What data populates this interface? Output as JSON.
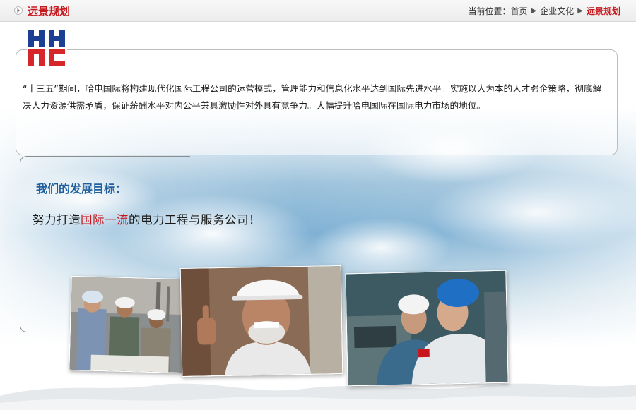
{
  "header": {
    "section_title": "远景规划",
    "breadcrumb": {
      "label": "当前位置：",
      "items": [
        "首页",
        "企业文化",
        "远景规划"
      ]
    }
  },
  "logo": {
    "text": "HEC"
  },
  "intro": {
    "text": "“十三五”期间，哈电国际将构建现代化国际工程公司的运营模式，管理能力和信息化水平达到国际先进水平。实施以人为本的人才强企策略，彻底解决人力资源供需矛盾，保证薪酬水平对内公平兼具激励性对外具有竞争力。大幅提升哈电国际在国际电力市场的地位。"
  },
  "goal": {
    "title": "我们的发展目标：",
    "text_before": "努力打造",
    "text_highlight": "国际一流",
    "text_after": "的电力工程与服务公司！"
  },
  "colors": {
    "accent_red": "#c8161d",
    "goal_blue": "#1f5f9e",
    "logo_blue": "#1b3f93",
    "logo_red": "#d7262a"
  },
  "icons": {
    "section_arrow": "arrow-right-icon",
    "breadcrumb_separator": "chevron-right-icon"
  }
}
